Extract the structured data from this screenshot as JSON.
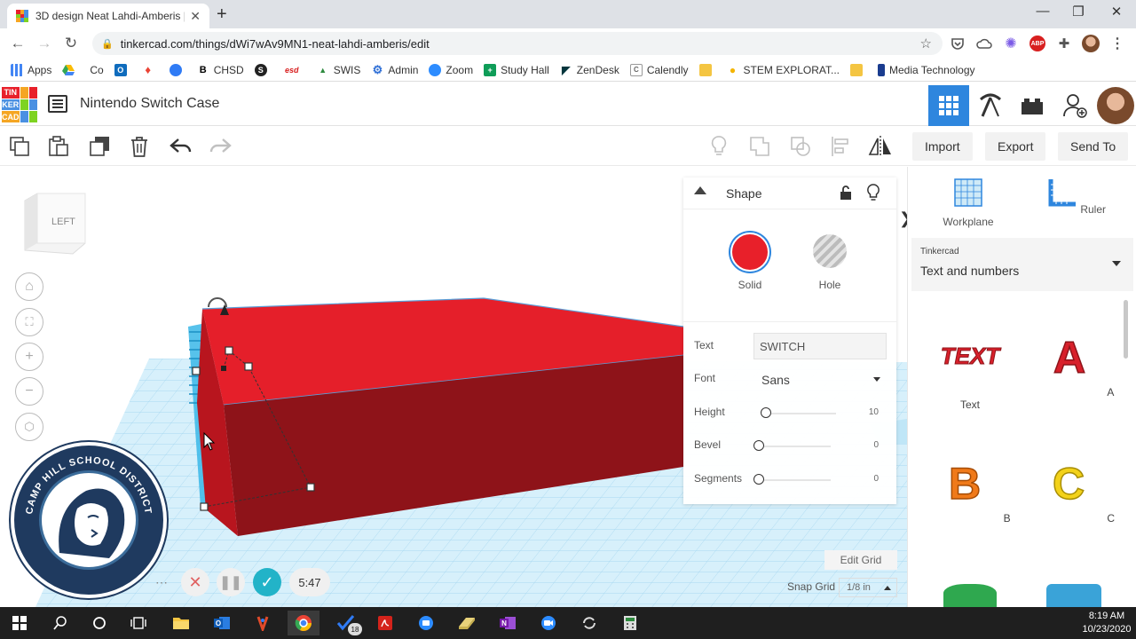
{
  "browser": {
    "tab_title": "3D design Neat Lahdi-Amberis |",
    "url": "tinkercad.com/things/dWi7wAv9MN1-neat-lahdi-amberis/edit",
    "bookmarks": [
      "Apps",
      "Co",
      "",
      "",
      "",
      "CHSD",
      "SWIS",
      "Admin",
      "Zoom",
      "Study Hall",
      "ZenDesk",
      "Calendly",
      "STEM EXPLORAT...",
      "",
      "Media Technology"
    ],
    "bookmark_icons": [
      "B",
      "S",
      "esd"
    ]
  },
  "app": {
    "logo_letters": [
      "TIN",
      "KER",
      "CAD"
    ],
    "design_title": "Nintendo Switch Case",
    "import_label": "Import",
    "export_label": "Export",
    "sendto_label": "Send To"
  },
  "viewcube": {
    "face_label": "LEFT"
  },
  "shape_panel": {
    "title": "Shape",
    "solid_label": "Solid",
    "hole_label": "Hole",
    "text_label": "Text",
    "text_value": "SWITCH",
    "font_label": "Font",
    "font_value": "Sans",
    "height_label": "Height",
    "height_value": "10",
    "bevel_label": "Bevel",
    "bevel_value": "0",
    "segments_label": "Segments",
    "segments_value": "0"
  },
  "grid": {
    "edit_grid_label": "Edit Grid",
    "snap_grid_label": "Snap Grid",
    "snap_value": "1/8 in"
  },
  "recording": {
    "timer": "5:47"
  },
  "seal": {
    "text": "CAMP HILL SCHOOL DISTRICT"
  },
  "right_panel": {
    "workplane_label": "Workplane",
    "ruler_label": "Ruler",
    "library_source": "Tinkercad",
    "library_name": "Text and numbers",
    "parts": [
      {
        "label": "Text",
        "glyph": "TEXT"
      },
      {
        "label": "A",
        "glyph": "A"
      },
      {
        "label": "B",
        "glyph": "B"
      },
      {
        "label": "C",
        "glyph": "C"
      }
    ]
  },
  "taskbar": {
    "badge": "18",
    "time": "8:19 AM",
    "date": "10/23/2020"
  },
  "colors": {
    "accent": "#2e86de",
    "solid_red": "#e8202a",
    "model_red_top": "#e51f2a",
    "model_red_side": "#8e1319",
    "grid_blue": "#cfeaf7"
  }
}
